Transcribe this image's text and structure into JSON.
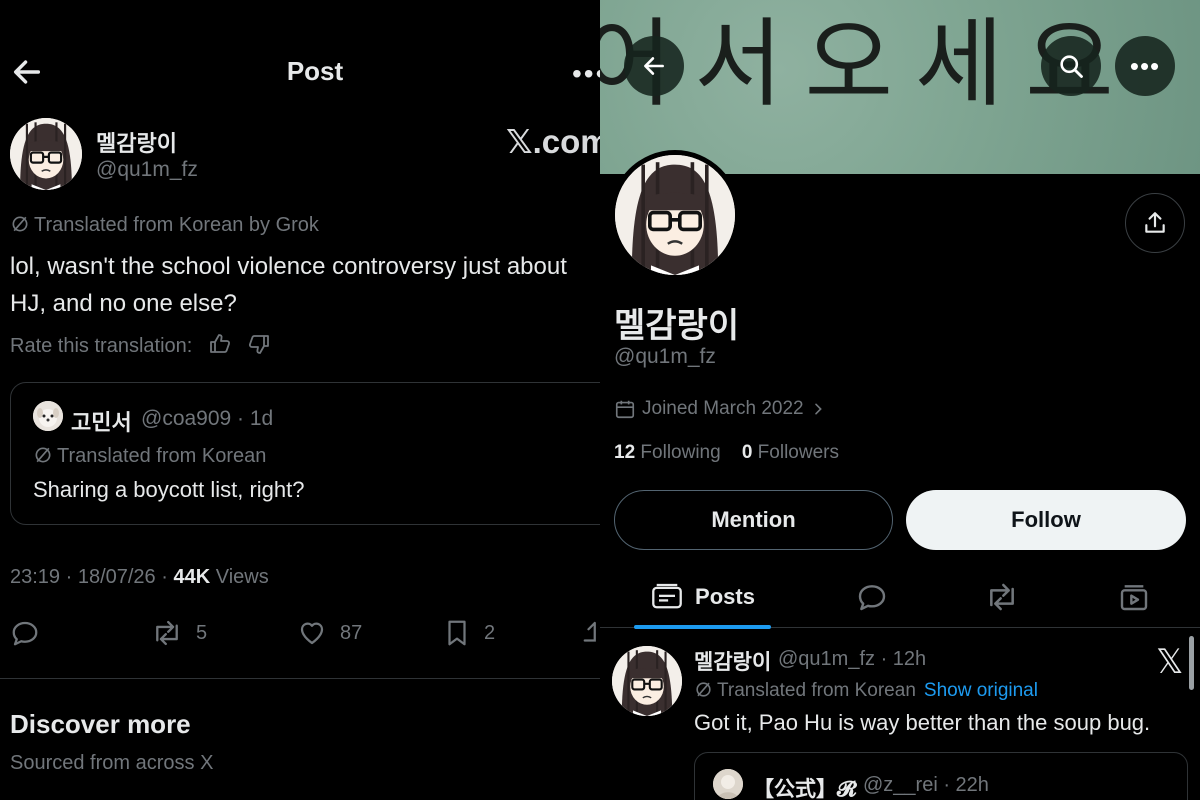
{
  "left": {
    "header": {
      "title": "Post",
      "more": "•••"
    },
    "author": {
      "name": "멜감랑이",
      "handle": "@qu1m_fz"
    },
    "watermark": "𝕏.com",
    "translation": {
      "label": "Translated from Korean by Grok"
    },
    "post_text": "lol, wasn't the school violence controversy just about HJ, and no one else?",
    "rate": {
      "label": "Rate this translation:"
    },
    "quote": {
      "name": "고민서",
      "handle": "@coa909 · 1d",
      "translated": "Translated from Korean",
      "text": "Sharing a boycott list, right?"
    },
    "meta": {
      "time": "23:19 · 18/07/26 · ",
      "views_count": "44K",
      "views_label": " Views"
    },
    "actions": {
      "reposts": "5",
      "likes": "87",
      "bookmarks": "2"
    },
    "discover": {
      "title": "Discover more",
      "subtitle": "Sourced from across X"
    }
  },
  "right": {
    "banner_text": "어서오세요",
    "header": {
      "more": "•••"
    },
    "profile": {
      "name": "멜감랑이",
      "handle": "@qu1m_fz",
      "joined": "Joined March 2022",
      "following_count": "12",
      "following_label": " Following",
      "followers_count": "0",
      "followers_label": " Followers"
    },
    "buttons": {
      "mention": "Mention",
      "follow": "Follow"
    },
    "tabs": {
      "posts": "Posts"
    },
    "feed": {
      "name": "멜감랑이",
      "handle": "@qu1m_fz · 12h",
      "x_mark": "𝕏",
      "translated": "Translated from Korean",
      "show_original": "Show original",
      "text": "Got it, Pao Hu is way better than the soup bug.",
      "quote_name": "【公式】𝓡",
      "quote_handle": "@z__rei · 22h"
    }
  },
  "colors": {
    "background": "#000000",
    "text": "#e7e9ea",
    "muted": "#71767b",
    "accent": "#1d9bf0",
    "banner": "#7fa592"
  }
}
